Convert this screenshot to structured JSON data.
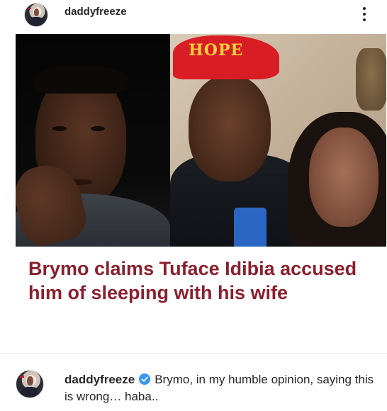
{
  "post": {
    "username": "daddyfreeze",
    "more_icon": "more-vertical-icon"
  },
  "image": {
    "cap_text": "HOPE",
    "headline": "Brymo claims Tuface Idibia accused him of sleeping with his wife",
    "headline_color": "#8b1f2d"
  },
  "comment": {
    "username": "daddyfreeze",
    "verified_icon": "verified-badge-icon",
    "verified_color": "#3897f0",
    "text": "Brymo, in my humble opinion, saying this is wrong… haba.."
  }
}
